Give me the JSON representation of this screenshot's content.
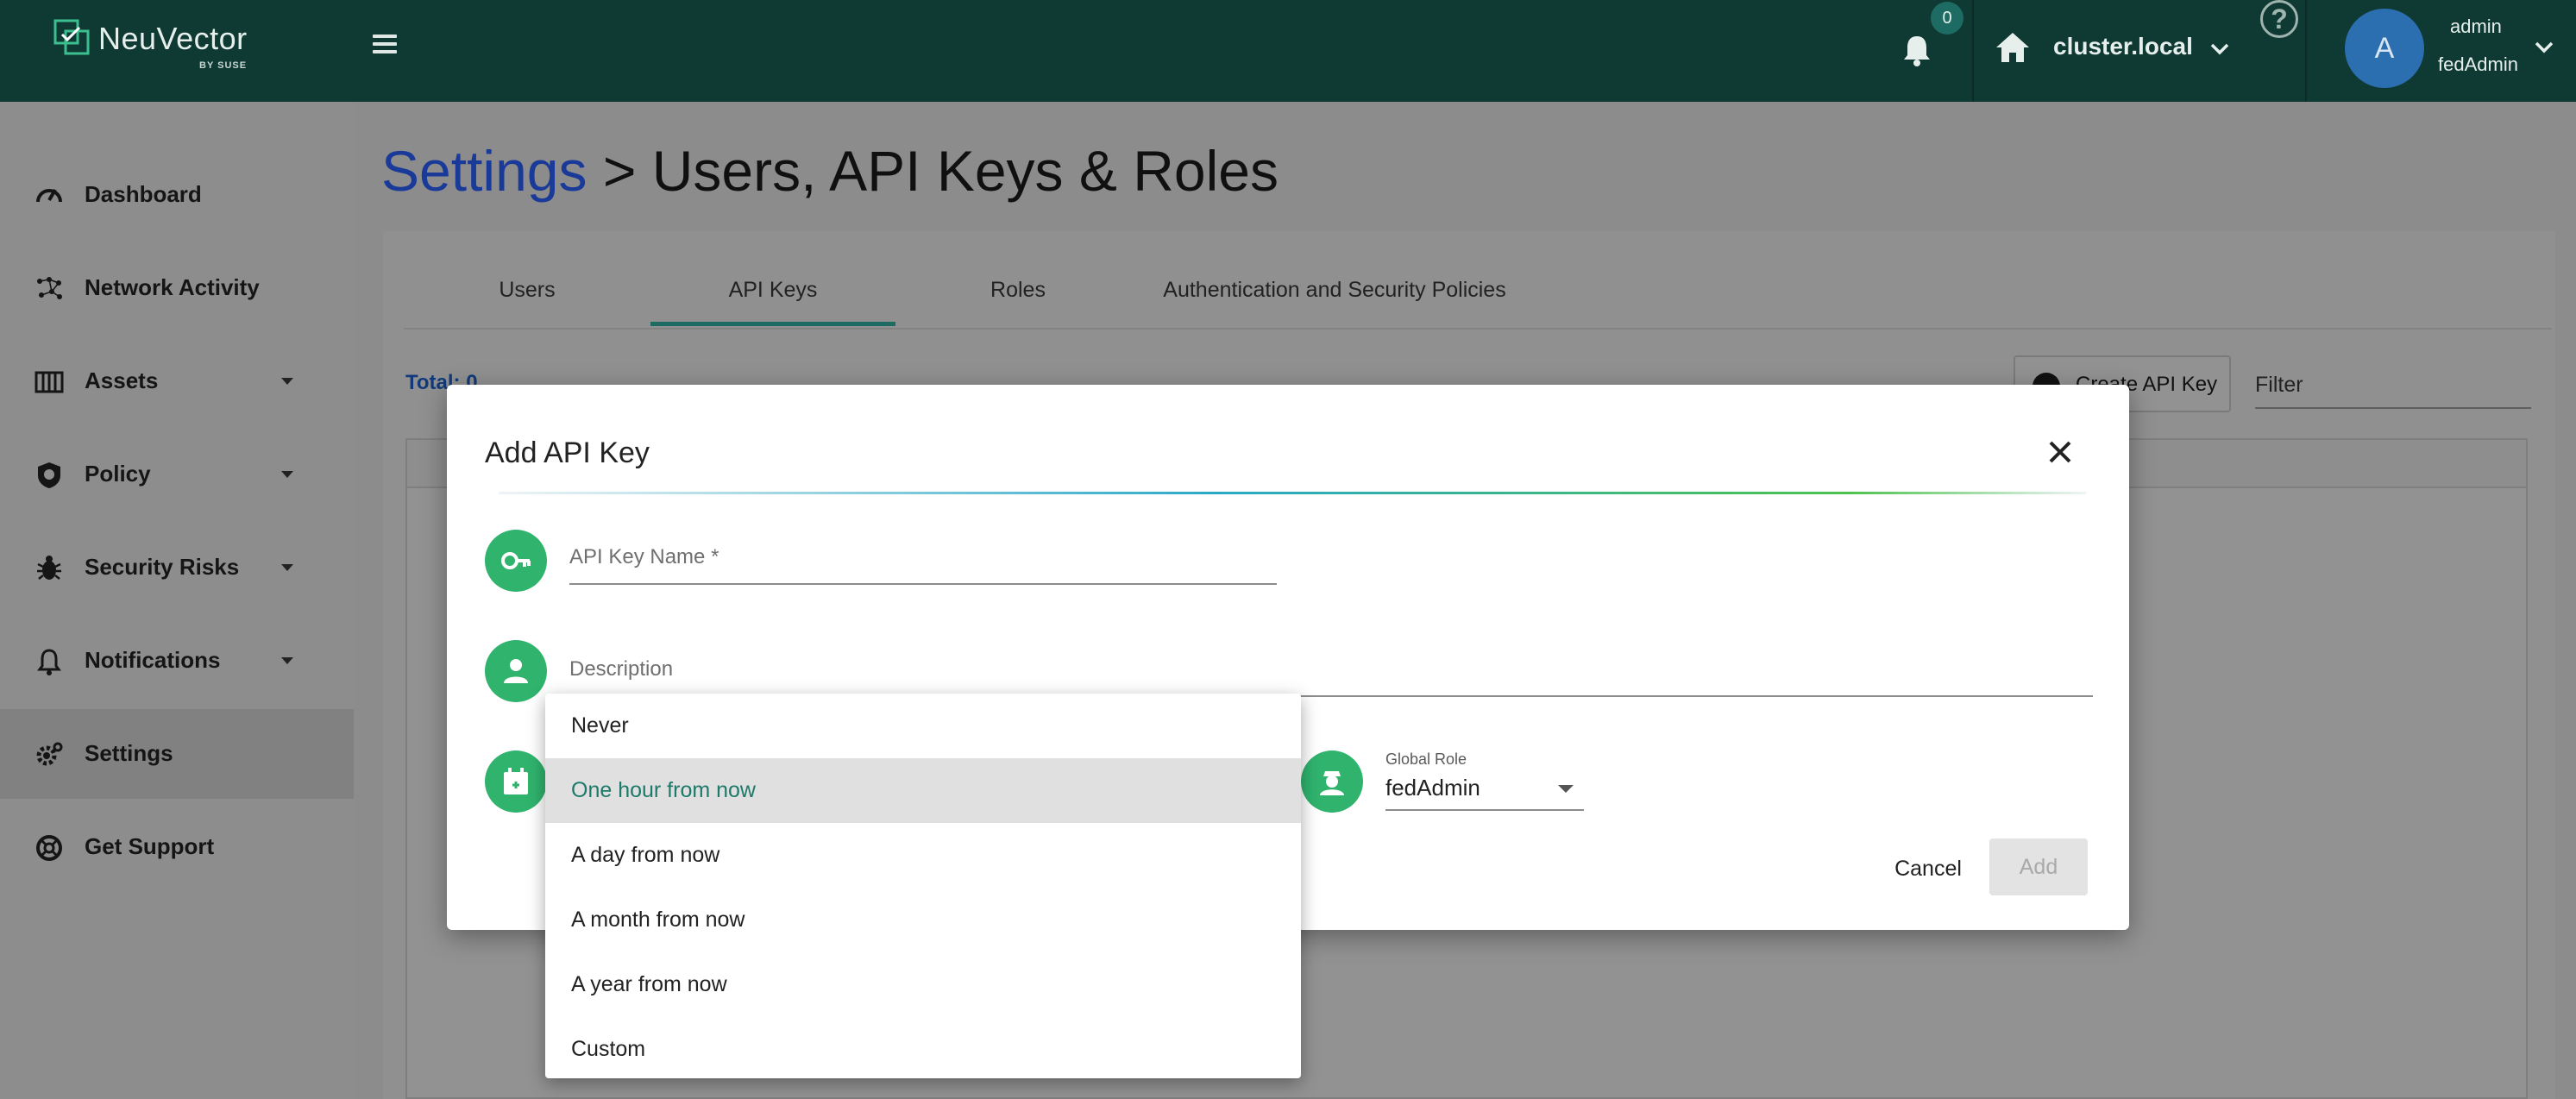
{
  "app": {
    "brand_name": "NeuVector",
    "brand_sub": "BY SUSE",
    "notifications_count": "0",
    "cluster_name": "cluster.local",
    "help_symbol": "?",
    "avatar_initial": "A",
    "user_name": "admin",
    "user_role": "fedAdmin"
  },
  "sidebar": {
    "items": [
      {
        "label": "Dashboard",
        "icon": "dashboard-icon"
      },
      {
        "label": "Network Activity",
        "icon": "network-icon"
      },
      {
        "label": "Assets",
        "icon": "assets-icon",
        "expandable": true
      },
      {
        "label": "Policy",
        "icon": "policy-icon",
        "expandable": true
      },
      {
        "label": "Security Risks",
        "icon": "bug-icon",
        "expandable": true
      },
      {
        "label": "Notifications",
        "icon": "bell-icon",
        "expandable": true
      },
      {
        "label": "Settings",
        "icon": "gear-icon",
        "active": true
      },
      {
        "label": "Get Support",
        "icon": "support-icon"
      }
    ]
  },
  "page": {
    "title_crumb": "Settings",
    "title_sep": ">",
    "title_rest": "Users, API Keys & Roles"
  },
  "tabs": [
    {
      "label": "Users"
    },
    {
      "label": "API Keys",
      "active": true
    },
    {
      "label": "Roles"
    },
    {
      "label": "Authentication and Security Policies"
    }
  ],
  "toolbar": {
    "total_label": "Total: 0",
    "create_label": "Create API Key",
    "filter_placeholder": "Filter"
  },
  "dialog": {
    "title": "Add API Key",
    "name_placeholder": "API Key Name *",
    "description_placeholder": "Description",
    "role_label": "Global Role",
    "role_value": "fedAdmin",
    "cancel_label": "Cancel",
    "add_label": "Add"
  },
  "expiry_menu": {
    "options": [
      {
        "label": "Never"
      },
      {
        "label": "One hour from now",
        "selected": true
      },
      {
        "label": "A day from now"
      },
      {
        "label": "A month from now"
      },
      {
        "label": "A year from now"
      },
      {
        "label": "Custom"
      }
    ]
  },
  "colors": {
    "topbar": "#0f3a34",
    "accent": "#1d6b62",
    "icon_green": "#2fb36d",
    "crumb_blue": "#1a3a9a"
  }
}
